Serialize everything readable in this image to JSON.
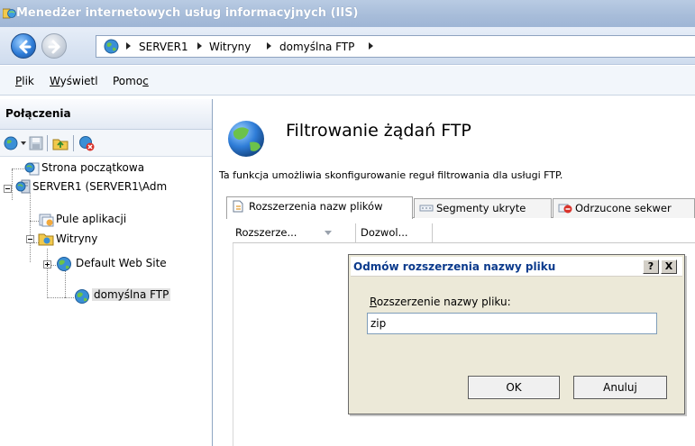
{
  "window": {
    "title": "Menedżer internetowych usług informacyjnych (IIS)"
  },
  "address": {
    "crumbs": [
      "SERVER1",
      "Witryny",
      "domyślna FTP"
    ]
  },
  "menu": {
    "items": [
      {
        "pre": "",
        "key": "P",
        "post": "lik"
      },
      {
        "pre": "",
        "key": "W",
        "post": "yświetl"
      },
      {
        "pre": "Pomo",
        "key": "c",
        "post": ""
      }
    ]
  },
  "connections": {
    "header": "Połączenia",
    "tree": [
      {
        "label": "Strona początkowa"
      },
      {
        "label": "SERVER1 (SERVER1\\Adm"
      },
      {
        "label": "Pule aplikacji"
      },
      {
        "label": "Witryny"
      },
      {
        "label": "Default Web Site"
      },
      {
        "label": "domyślna FTP"
      }
    ]
  },
  "feature": {
    "title": "Filtrowanie żądań FTP",
    "description": "Ta funkcja umożliwia skonfigurowanie reguł filtrowania dla usługi FTP.",
    "tabs": [
      {
        "label": "Rozszerzenia nazw plików"
      },
      {
        "label": "Segmenty ukryte"
      },
      {
        "label": "Odrzucone sekwer"
      }
    ],
    "columns": [
      "Rozszerze...",
      "Dozwol..."
    ]
  },
  "dialog": {
    "title": "Odmów rozszerzenia nazwy pliku",
    "help_label": "?",
    "close_label": "X",
    "field_label_key": "R",
    "field_label_rest": "ozszerzenie nazwy pliku:",
    "field_value": "zip",
    "ok_label": "OK",
    "cancel_label": "Anuluj"
  }
}
